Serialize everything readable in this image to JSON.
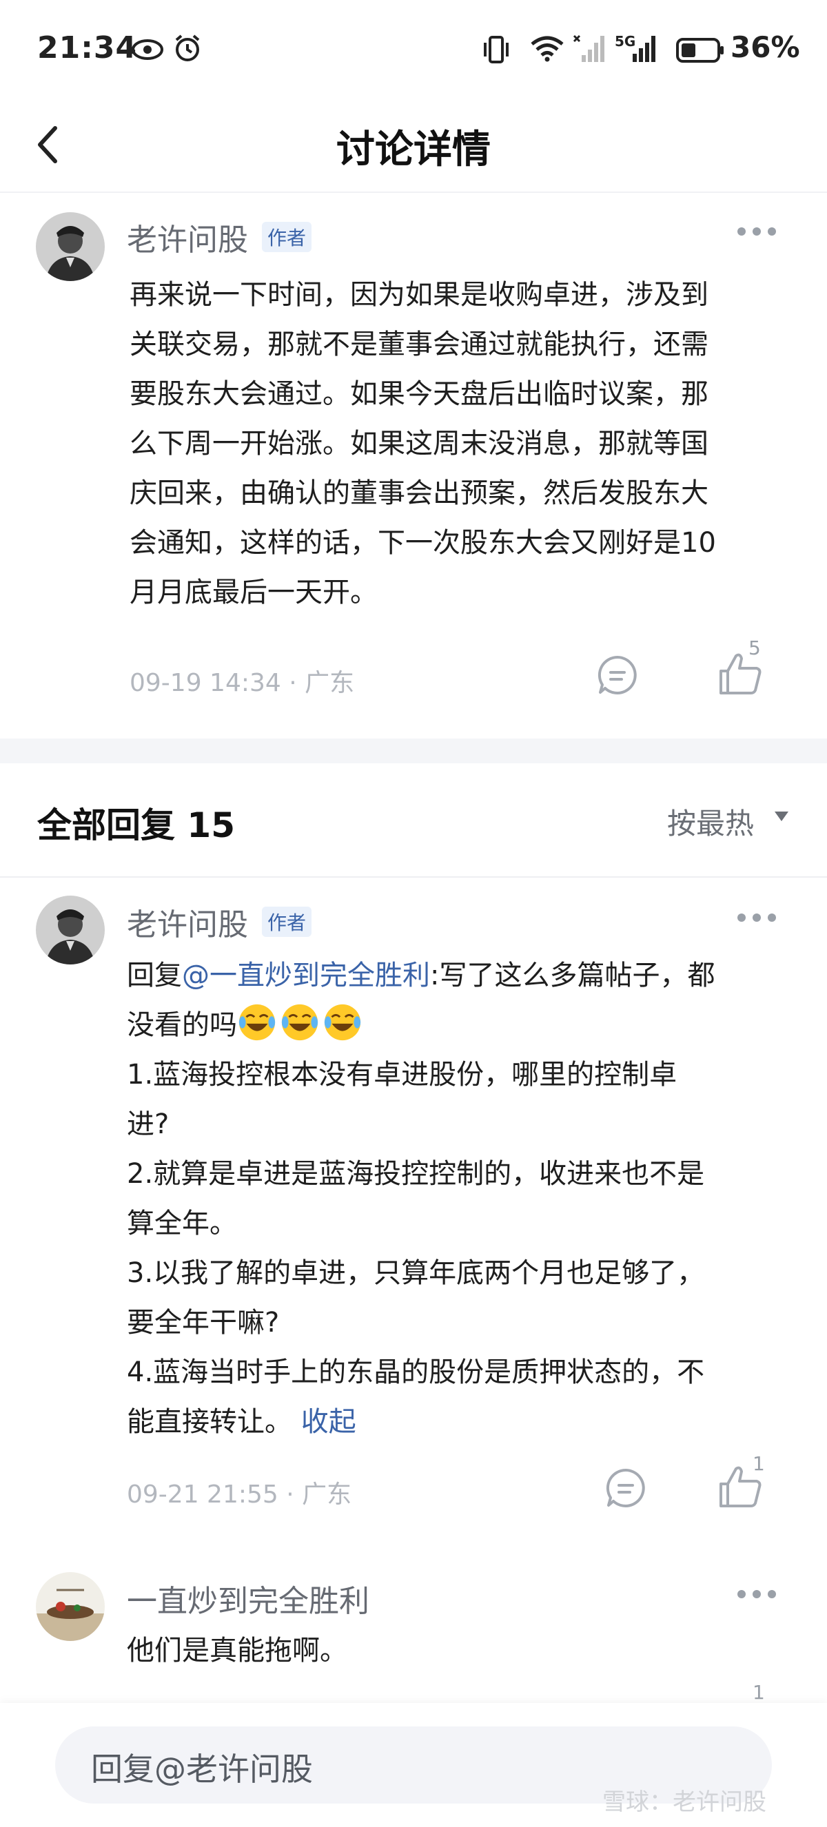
{
  "status_bar": {
    "time": "21:34",
    "battery": "36%",
    "network": "5G",
    "icons": [
      "eye-icon",
      "alarm-icon",
      "vibrate-icon",
      "wifi-icon",
      "signal-icon",
      "battery-icon"
    ]
  },
  "nav": {
    "back_icon": "back-chevron-icon",
    "title": "讨论详情"
  },
  "main_post": {
    "author": "老许问股",
    "badge": "作者",
    "lines": [
      "再来说一下时间，因为如果是收购卓进，涉及到",
      "关联交易，那就不是董事会通过就能执行，还需",
      "要股东大会通过。如果今天盘后出临时议案，那",
      "么下周一开始涨。如果这周末没消息，那就等国",
      "庆回来，由确认的董事会出预案，然后发股东大",
      "会通知，这样的话，下一次股东大会又刚好是10",
      "月月底最后一天开。"
    ],
    "time": "09-19 14:34",
    "location": "广东",
    "like_count": "5"
  },
  "replies_header": {
    "title": "全部回复 15",
    "sort": "按最热"
  },
  "replies": [
    {
      "author": "老许问股",
      "badge": "作者",
      "prefix": "回复",
      "mention": "@一直炒到完全胜利",
      "first_line_rest": ":写了这么多篇帖子，都",
      "second_line": "没看的吗",
      "emoji_name": "laugh-cry-emoji",
      "lines": [
        "1.蓝海投控根本没有卓进股份，哪里的控制卓",
        "进?",
        "2.就算是卓进是蓝海投控控制的，收进来也不是",
        "算全年。",
        "3.以我了解的卓进，只算年底两个月也足够了，",
        "要全年干嘛?",
        "4.蓝海当时手上的东晶的股份是质押状态的，不"
      ],
      "last_line": "能直接转让。",
      "collapse": "收起",
      "time": "09-21 21:55",
      "location": "广东",
      "like_count": "1"
    },
    {
      "author": "一直炒到完全胜利",
      "text": "他们是真能拖啊。",
      "like_count": "1"
    }
  ],
  "bottom_bar": {
    "reply_placeholder": "回复@老许问股",
    "watermark": "雪球：老许问股"
  },
  "colors": {
    "accent_blue": "#3a63a8",
    "muted_gray": "#b3b7be",
    "section_gap": "#f4f5f8"
  }
}
